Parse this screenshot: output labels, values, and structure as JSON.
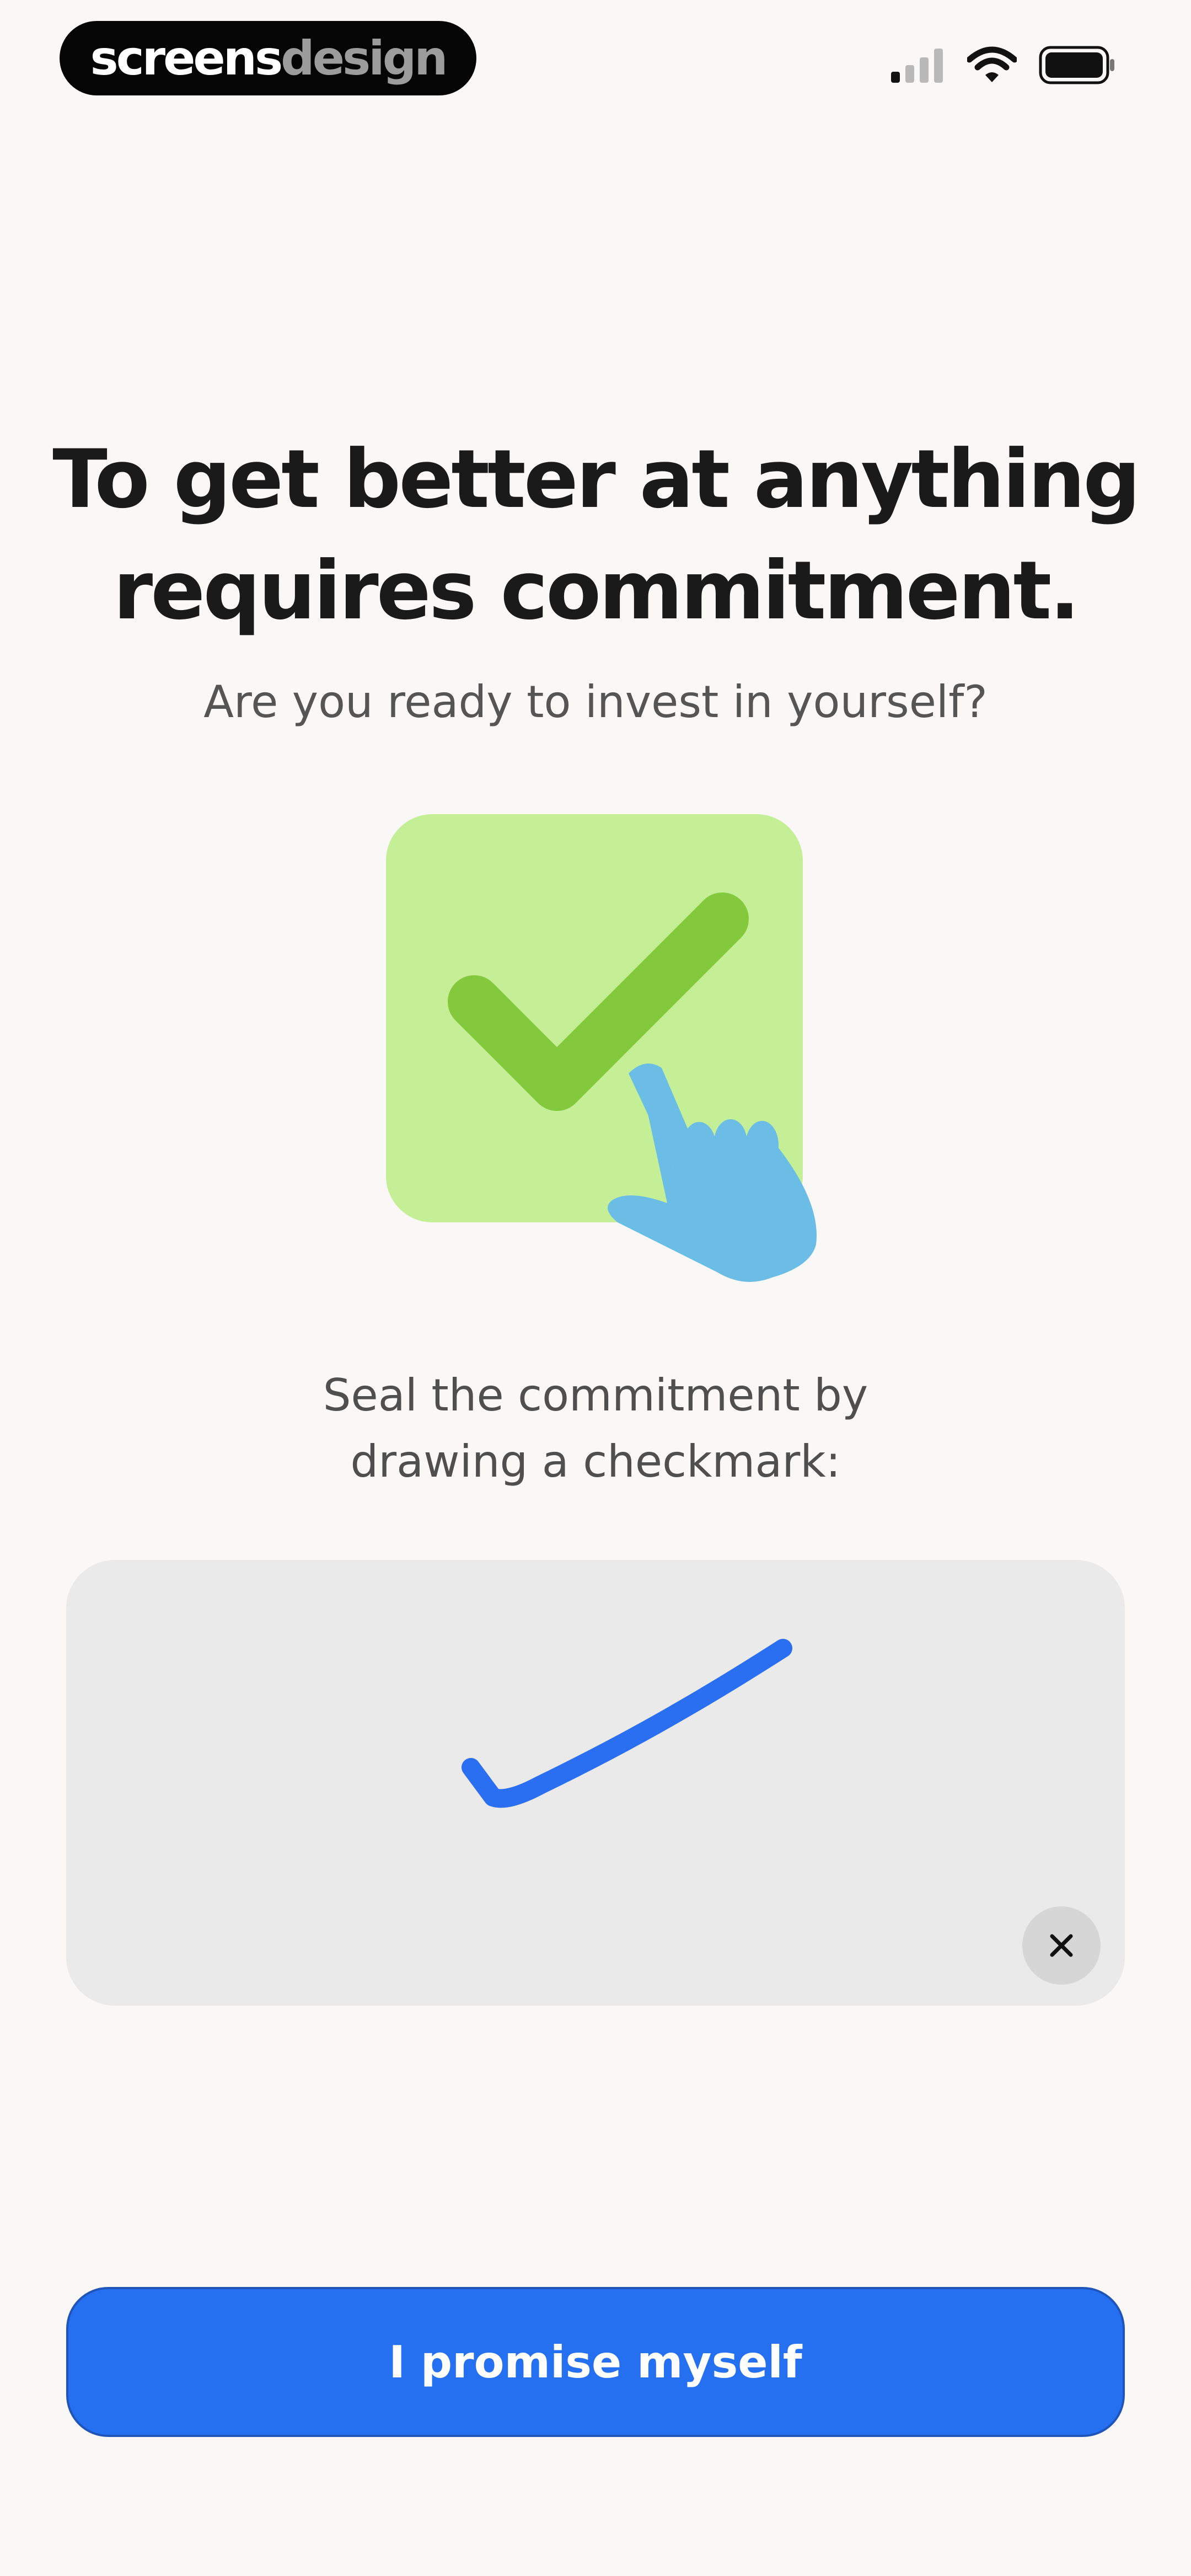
{
  "brand": {
    "part1": "screens",
    "part2": "design"
  },
  "status_bar": {
    "icons": [
      "cellular-signal-icon",
      "wifi-icon",
      "battery-icon"
    ]
  },
  "content": {
    "headline_line1": "To get better at anything",
    "headline_line2": "requires commitment.",
    "subtitle": "Are you ready to invest in yourself?",
    "illustration_icon": "checkbox-hand-icon",
    "instruction_line1": "Seal the commitment by",
    "instruction_line2": "drawing a checkmark:"
  },
  "drawing_pad": {
    "stroke_color": "#2a6ff2",
    "clear_icon": "close-icon"
  },
  "cta": {
    "label": "I promise myself"
  },
  "colors": {
    "background": "#f9f8f7",
    "accent": "#256ff1",
    "illustration_bg": "#c5ef96",
    "check": "#84c83e",
    "hand": "#6bbde6"
  }
}
